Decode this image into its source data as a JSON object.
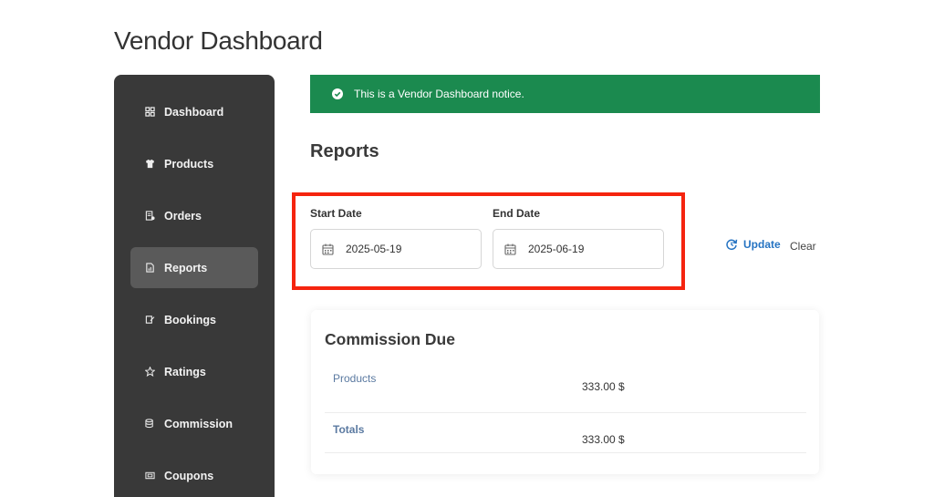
{
  "page": {
    "title": "Vendor Dashboard"
  },
  "sidebar": {
    "items": [
      {
        "label": "Dashboard",
        "icon": "dashboard-grid-icon",
        "active": false
      },
      {
        "label": "Products",
        "icon": "shirt-icon",
        "active": false
      },
      {
        "label": "Orders",
        "icon": "receipt-icon",
        "active": false
      },
      {
        "label": "Reports",
        "icon": "report-icon",
        "active": true
      },
      {
        "label": "Bookings",
        "icon": "booking-icon",
        "active": false
      },
      {
        "label": "Ratings",
        "icon": "star-icon",
        "active": false
      },
      {
        "label": "Commission",
        "icon": "coins-icon",
        "active": false
      },
      {
        "label": "Coupons",
        "icon": "coupon-icon",
        "active": false
      }
    ]
  },
  "notice": {
    "text": "This is a Vendor Dashboard notice.",
    "color": "#1b8a4f",
    "icon": "check-circle-icon"
  },
  "reports": {
    "title": "Reports",
    "start_label": "Start Date",
    "start_value": "2025-05-19",
    "end_label": "End Date",
    "end_value": "2025-06-19",
    "update_label": "Update",
    "clear_label": "Clear",
    "highlight_color": "#f5240f"
  },
  "commission": {
    "title": "Commission Due",
    "rows": [
      {
        "label": "Products",
        "value": "333.00 $"
      },
      {
        "label": "Totals",
        "value": "333.00 $"
      }
    ]
  }
}
